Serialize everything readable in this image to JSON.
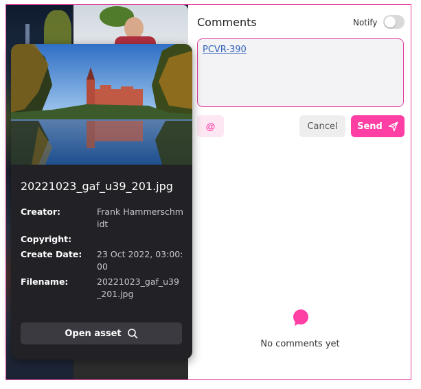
{
  "asset": {
    "title": "20221023_gaf_u39_201.jpg",
    "metadata": [
      {
        "key": "Creator:",
        "value": "Frank Hammerschmidt"
      },
      {
        "key": "Copyright:",
        "value": ""
      },
      {
        "key": "Create Date:",
        "value": "23 Oct 2022, 03:00:00"
      },
      {
        "key": "Filename:",
        "value": "20221023_gaf_u39_201.jpg"
      }
    ],
    "open_label": "Open asset"
  },
  "comments": {
    "title": "Comments",
    "notify_label": "Notify",
    "notify_on": false,
    "draft_text": "PCVR-390",
    "mention_label": "@",
    "cancel_label": "Cancel",
    "send_label": "Send",
    "empty_text": "No comments yet"
  },
  "colors": {
    "accent": "#ff3fa4",
    "popover_bg": "#212126",
    "link": "#2b5fb8"
  }
}
